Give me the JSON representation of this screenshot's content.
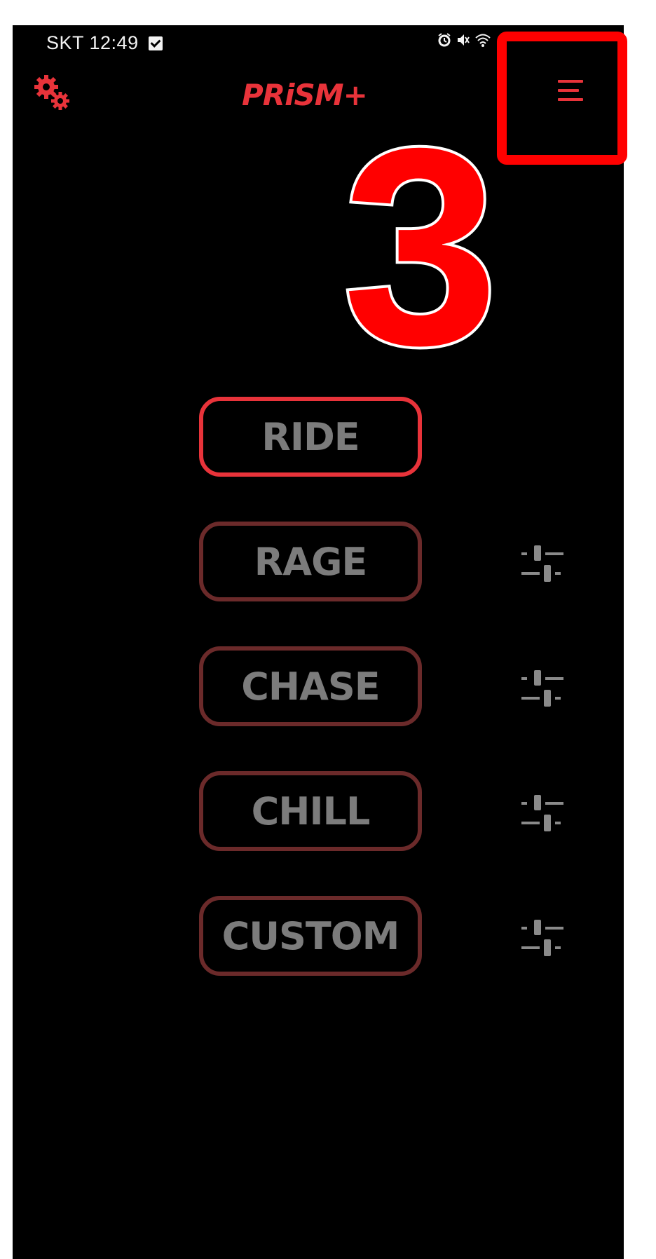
{
  "status_bar": {
    "carrier_time": "SKT 12:49"
  },
  "header": {
    "logo_text": "PRiSM+",
    "settings_icon": "gears-icon",
    "menu_icon": "hamburger-menu-icon"
  },
  "annotation": {
    "number": "3"
  },
  "modes": [
    {
      "label": "RIDE",
      "active": true,
      "has_settings": false
    },
    {
      "label": "RAGE",
      "active": false,
      "has_settings": true
    },
    {
      "label": "CHASE",
      "active": false,
      "has_settings": true
    },
    {
      "label": "CHILL",
      "active": false,
      "has_settings": true
    },
    {
      "label": "CUSTOM",
      "active": false,
      "has_settings": true
    }
  ],
  "colors": {
    "accent": "#e8333a",
    "inactive_border": "#6b2a2a",
    "label_gray": "#7c7c7c",
    "annotation": "#ff0000"
  }
}
